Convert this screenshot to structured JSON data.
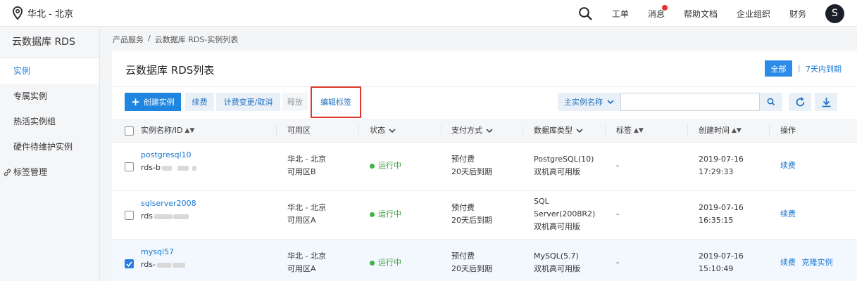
{
  "topbar": {
    "region": "华北 - 北京",
    "nav": [
      "工单",
      "消息",
      "帮助文档",
      "企业组织",
      "财务"
    ],
    "avatar": "S"
  },
  "sidebar": {
    "title": "云数据库 RDS",
    "items": [
      {
        "label": "实例",
        "active": true
      },
      {
        "label": "专属实例"
      },
      {
        "label": "热活实例组"
      },
      {
        "label": "硬件待维护实例"
      },
      {
        "label": "标签管理"
      }
    ]
  },
  "breadcrumb": {
    "root": "产品服务",
    "sep": "/",
    "current": "云数据库 RDS-实例列表"
  },
  "panel": {
    "title": "云数据库 RDS列表",
    "filter_all": "全部",
    "filter_sep": "|",
    "filter_7d": "7天内到期"
  },
  "toolbar": {
    "create": "创建实例",
    "renew": "续费",
    "billing": "计费变更/取消",
    "release": "释放",
    "edit_tags": "编辑标签",
    "search_field": "主实例名称",
    "search_value": ""
  },
  "table": {
    "headers": {
      "name": "实例名称/ID",
      "zone": "可用区",
      "status": "状态",
      "payment": "支付方式",
      "dbtype": "数据库类型",
      "tags": "标签",
      "created": "创建时间",
      "actions": "操作"
    },
    "rows": [
      {
        "name": "postgresql10",
        "id": "rds-b",
        "zone1": "华北 - 北京",
        "zone2": "可用区B",
        "status": "运行中",
        "pay1": "预付费",
        "pay2": "20天后到期",
        "db": [
          "PostgreSQL(10)",
          "双机高可用版"
        ],
        "tags": "-",
        "date": "2019-07-16",
        "time": "17:29:33",
        "actions": [
          "续费"
        ],
        "checked": false
      },
      {
        "name": "sqlserver2008",
        "id": "rds",
        "zone1": "华北 - 北京",
        "zone2": "可用区A",
        "status": "运行中",
        "pay1": "预付费",
        "pay2": "20天后到期",
        "db": [
          "SQL",
          "Server(2008R2)",
          "双机高可用版"
        ],
        "tags": "-",
        "date": "2019-07-16",
        "time": "16:35:15",
        "actions": [
          "续费"
        ],
        "checked": false
      },
      {
        "name": "mysql57",
        "id": "rds-",
        "zone1": "华北 - 北京",
        "zone2": "可用区A",
        "status": "运行中",
        "pay1": "预付费",
        "pay2": "20天后到期",
        "db": [
          "MySQL(5.7)",
          "双机高可用版"
        ],
        "tags": "-",
        "date": "2019-07-16",
        "time": "15:10:49",
        "actions": [
          "续费",
          "克隆实例"
        ],
        "checked": true
      }
    ]
  },
  "colors": {
    "accent": "#1f86e0",
    "link": "#1677d2",
    "running": "#3db34a",
    "highlight": "#d93a2b"
  }
}
